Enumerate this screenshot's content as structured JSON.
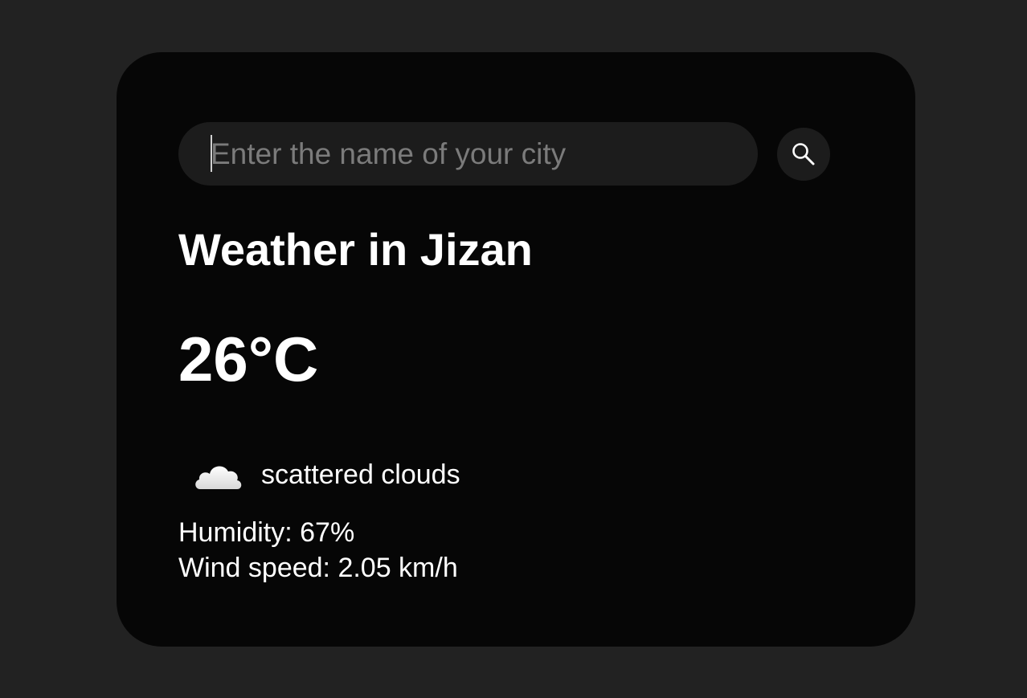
{
  "search": {
    "placeholder": "Enter the name of your city",
    "value": "",
    "button_icon": "search-icon"
  },
  "weather": {
    "title": "Weather in Jizan",
    "temperature": "26°C",
    "condition_icon": "cloud-icon",
    "description": "scattered clouds",
    "humidity": "Humidity: 67%",
    "wind": "Wind speed: 2.05 km/h"
  },
  "colors": {
    "page_background": "#222222",
    "card_background": "#060606",
    "input_background": "#1c1c1c",
    "text": "#ffffff",
    "placeholder": "#7b7b7b"
  }
}
